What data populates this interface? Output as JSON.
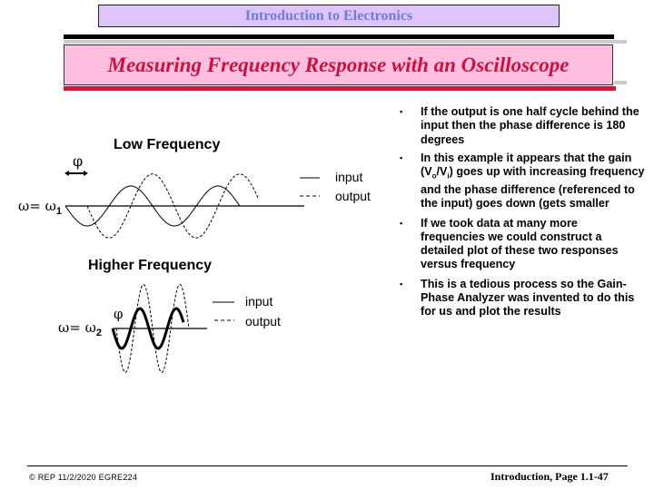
{
  "header": {
    "course_title": "Introduction to Electronics",
    "slide_title": "Measuring Frequency Response with an Oscilloscope"
  },
  "colors": {
    "course_box_bg": "#dfc4fb",
    "course_text": "#6a7ee0",
    "title_box_bg": "#ffbfe0",
    "title_text": "#d0103a",
    "accent_red": "#e0103a"
  },
  "low_frequency": {
    "label": "Low Frequency",
    "phi_symbol": "φ",
    "omega_label": "ω= ω",
    "omega_subscript": "1",
    "legend": {
      "input": "input",
      "output": "output"
    },
    "input_amplitude_rel": 1.0,
    "output_amplitude_rel": 1.6,
    "output_lag_cycles": 0.25
  },
  "higher_frequency": {
    "label": "Higher Frequency",
    "phi_symbol": "φ",
    "omega_label": "ω= ω",
    "omega_subscript": "2",
    "legend": {
      "input": "input",
      "output": "output"
    },
    "input_amplitude_rel": 1.0,
    "output_amplitude_rel": 2.2,
    "output_lag_cycles": 0.1
  },
  "bullets": [
    "If the output is one half cycle behind the input then the phase difference is 180 degrees",
    "In this example it appears that the gain (V_o/V_i) goes up with increasing frequency and the phase difference (referenced to the input) goes down (gets smaller",
    "If we took data at many more frequencies we could construct a detailed plot of these two responses versus frequency",
    "This is a tedious process so the Gain-Phase Analyzer was invented to do this for us and plot the results"
  ],
  "bullet_parts": {
    "b2_pre": "In this example it appears that the gain (V",
    "b2_sub1": "o",
    "b2_mid": "/V",
    "b2_sub2": "i",
    "b2_post": ") goes up with increasing frequency and the phase difference (referenced to the input) goes down (gets smaller"
  },
  "bullet_marker": "▪",
  "footer": {
    "left": "© REP  11/2/2020  EGRE224",
    "right": "Introduction, Page 1.1-47"
  }
}
